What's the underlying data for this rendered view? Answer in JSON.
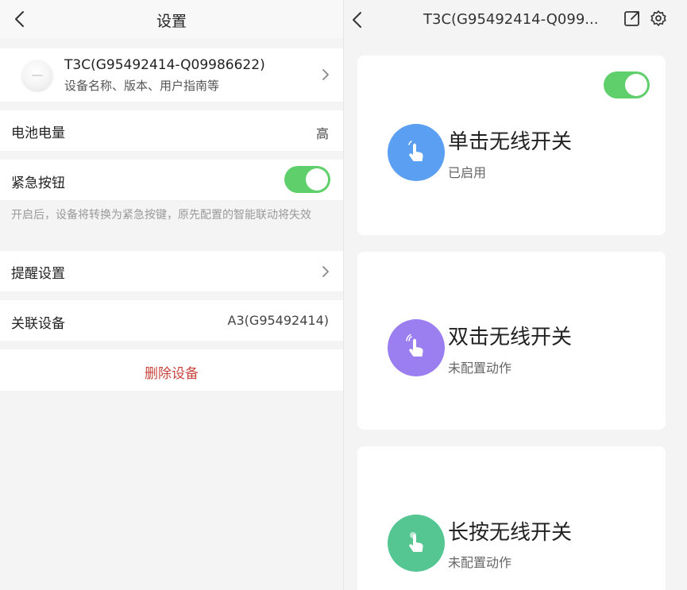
{
  "settings": {
    "title": "设置",
    "device": {
      "name": "T3C(G95492414-Q09986622)",
      "subtitle": "设备名称、版本、用户指南等"
    },
    "battery": {
      "label": "电池电量",
      "value": "高"
    },
    "emergency": {
      "label": "紧急按钮",
      "enabled": true,
      "hint": "开启后，设备将转换为紧急按键，原先配置的智能联动将失效"
    },
    "reminder": {
      "label": "提醒设置"
    },
    "linked": {
      "label": "关联设备",
      "value": "A3(G95492414)"
    },
    "delete_label": "删除设备"
  },
  "detail": {
    "title": "T3C(G95492414-Q099...",
    "master_toggle_on": true,
    "buttons": [
      {
        "name": "单击无线开关",
        "status": "已启用",
        "color": "#5a9ff2",
        "icon": "single-tap-hand-icon"
      },
      {
        "name": "双击无线开关",
        "status": "未配置动作",
        "color": "#9b7ef0",
        "icon": "double-tap-hand-icon"
      },
      {
        "name": "长按无线开关",
        "status": "未配置动作",
        "color": "#55c691",
        "icon": "long-press-hand-icon"
      }
    ]
  },
  "colors": {
    "toggle_on": "#5fcf6b",
    "danger": "#c8453f"
  }
}
